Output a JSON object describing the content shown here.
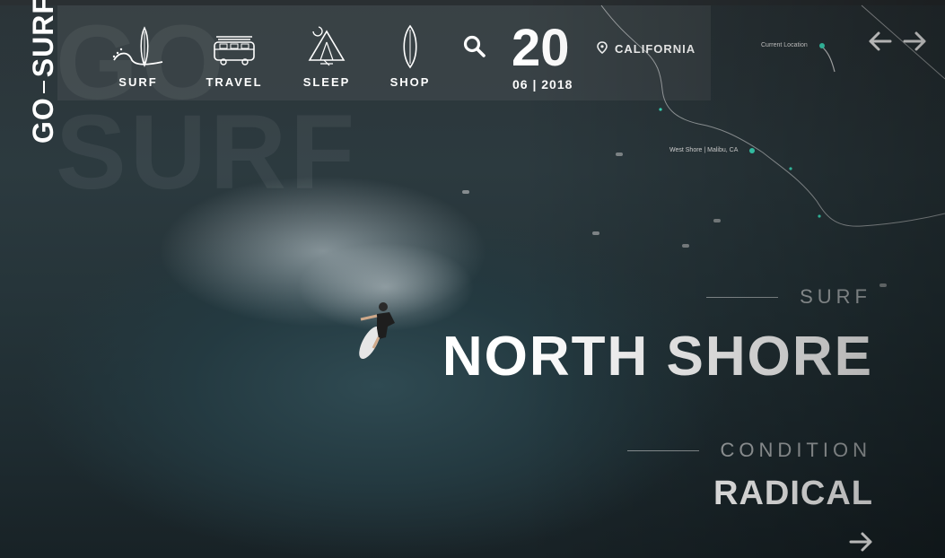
{
  "brand": {
    "vertical_text": "GO",
    "vertical_text2": "SURF",
    "background_text": "GO\nSURF"
  },
  "nav": {
    "items": [
      {
        "label": "SURF",
        "icon": "surf-wave-icon"
      },
      {
        "label": "TRAVEL",
        "icon": "van-icon"
      },
      {
        "label": "SLEEP",
        "icon": "tent-icon"
      },
      {
        "label": "SHOP",
        "icon": "surfboard-icon"
      }
    ]
  },
  "search": {
    "icon": "search-icon"
  },
  "date": {
    "day": "20",
    "month_year": "06 | 2018"
  },
  "location": {
    "icon": "map-pin-icon",
    "name": "CALIFORNIA"
  },
  "map": {
    "current_location_label": "Current Location",
    "spot_label": "West Shore | Malibu, CA",
    "accent_color": "#3ee6c4"
  },
  "arrows": {
    "prev": "←",
    "next": "→"
  },
  "hero": {
    "kicker": "SURF",
    "title": "NORTH SHORE",
    "condition_kicker": "CONDITION",
    "condition_value": "RADICAL",
    "next_arrow": "→"
  },
  "colors": {
    "text": "#ffffff",
    "panel": "#464c50",
    "accent": "#3ee6c4"
  }
}
